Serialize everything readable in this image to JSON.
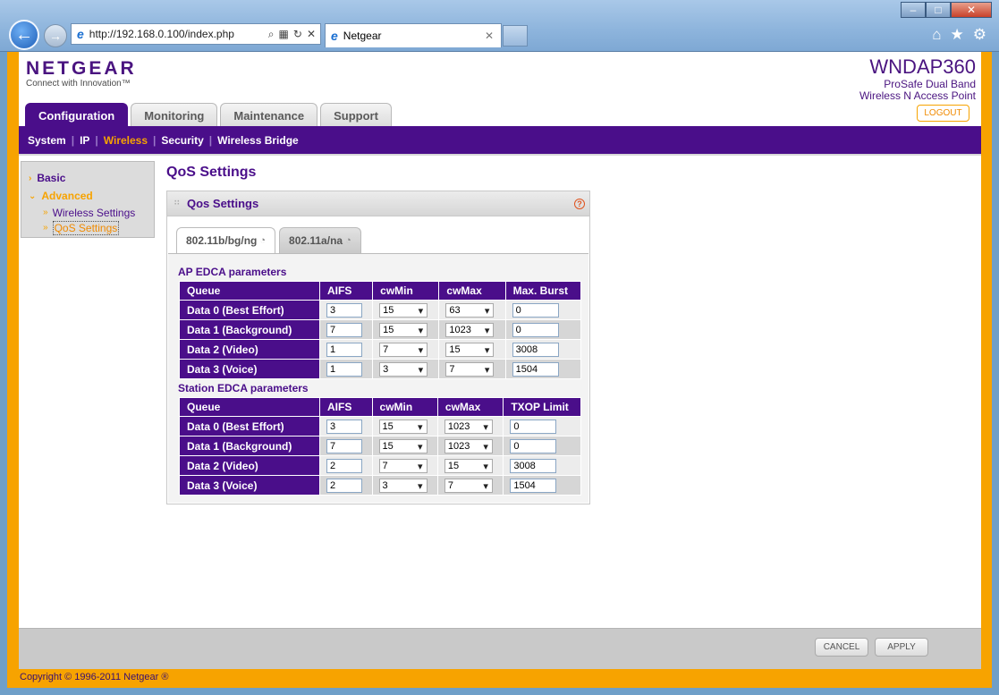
{
  "browser": {
    "url": "http://192.168.0.100/index.php",
    "tab_title": "Netgear"
  },
  "header": {
    "brand": "NETGEAR",
    "tagline": "Connect with Innovation™",
    "model": "WNDAP360",
    "model_line1": "ProSafe Dual Band",
    "model_line2": "Wireless N Access Point",
    "logout": "LOGOUT"
  },
  "main_tabs": [
    "Configuration",
    "Monitoring",
    "Maintenance",
    "Support"
  ],
  "sub_nav": [
    "System",
    "IP",
    "Wireless",
    "Security",
    "Wireless Bridge"
  ],
  "sidebar": {
    "basic": "Basic",
    "advanced": "Advanced",
    "items": [
      "Wireless Settings",
      "QoS Settings"
    ]
  },
  "content": {
    "title": "QoS Settings",
    "panel_title": "Qos Settings",
    "radio_tabs": [
      "802.11b/bg/ng",
      "802.11a/na"
    ],
    "ap_title": "AP EDCA parameters",
    "station_title": "Station EDCA parameters",
    "ap_headers": [
      "Queue",
      "AIFS",
      "cwMin",
      "cwMax",
      "Max. Burst"
    ],
    "station_headers": [
      "Queue",
      "AIFS",
      "cwMin",
      "cwMax",
      "TXOP Limit"
    ],
    "ap_rows": [
      {
        "queue": "Data 0 (Best Effort)",
        "aifs": "3",
        "cwmin": "15",
        "cwmax": "63",
        "last": "0"
      },
      {
        "queue": "Data 1 (Background)",
        "aifs": "7",
        "cwmin": "15",
        "cwmax": "1023",
        "last": "0"
      },
      {
        "queue": "Data 2 (Video)",
        "aifs": "1",
        "cwmin": "7",
        "cwmax": "15",
        "last": "3008"
      },
      {
        "queue": "Data 3 (Voice)",
        "aifs": "1",
        "cwmin": "3",
        "cwmax": "7",
        "last": "1504"
      }
    ],
    "station_rows": [
      {
        "queue": "Data 0 (Best Effort)",
        "aifs": "3",
        "cwmin": "15",
        "cwmax": "1023",
        "last": "0"
      },
      {
        "queue": "Data 1 (Background)",
        "aifs": "7",
        "cwmin": "15",
        "cwmax": "1023",
        "last": "0"
      },
      {
        "queue": "Data 2 (Video)",
        "aifs": "2",
        "cwmin": "7",
        "cwmax": "15",
        "last": "3008"
      },
      {
        "queue": "Data 3 (Voice)",
        "aifs": "2",
        "cwmin": "3",
        "cwmax": "7",
        "last": "1504"
      }
    ]
  },
  "footer": {
    "cancel": "CANCEL",
    "apply": "APPLY",
    "copyright": "Copyright © 1996-2011 Netgear ®"
  }
}
